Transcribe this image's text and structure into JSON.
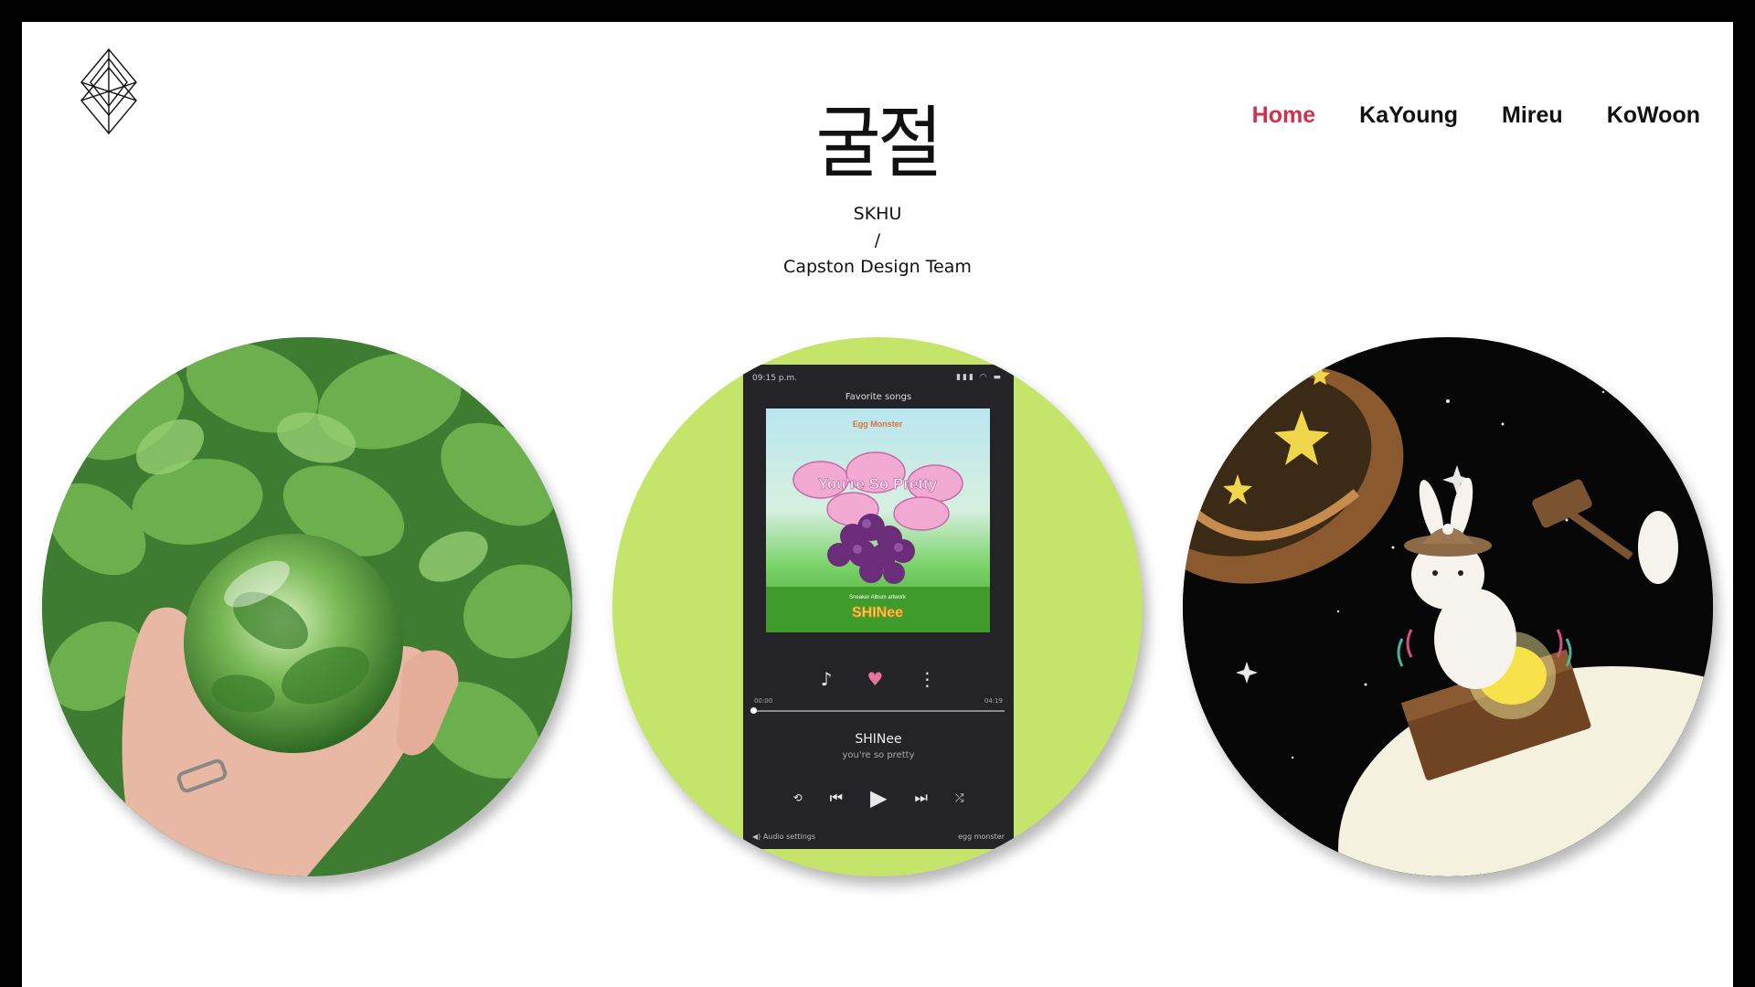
{
  "nav": {
    "items": [
      {
        "label": "Home",
        "active": true
      },
      {
        "label": "KaYoung",
        "active": false
      },
      {
        "label": "Mireu",
        "active": false
      },
      {
        "label": "KoWoon",
        "active": false
      }
    ]
  },
  "header": {
    "title": "굴절",
    "subtitle_line1": "SKHU",
    "subtitle_line2": "/",
    "subtitle_line3": "Capston Design Team"
  },
  "colors": {
    "active_nav": "#d32f4f",
    "middle_circle_bg": "#c5e56a",
    "phone_bg": "#242428",
    "heart": "#e9739a"
  },
  "gallery": {
    "items": [
      {
        "name": "glass-ball-leaves-image"
      },
      {
        "name": "music-player-image",
        "phone": {
          "time": "09:15 p.m.",
          "playlist_title": "Favorite songs",
          "elapsed": "00:00",
          "duration": "04:19",
          "artist": "SHINee",
          "song": "you're so pretty",
          "audio_settings": "Audio settings",
          "source": "egg monster",
          "album_brand": "Egg Monster",
          "album_title": "You're So Pretty",
          "album_artist": "SHINee"
        }
      },
      {
        "name": "rabbit-moon-illustration"
      }
    ]
  },
  "icons": {
    "logo": "diamond-logo-icon",
    "music_note": "music-note-icon",
    "heart": "heart-icon",
    "more": "more-vertical-icon",
    "repeat": "repeat-icon",
    "previous": "previous-icon",
    "play": "play-icon",
    "next": "next-icon",
    "shuffle": "shuffle-icon"
  }
}
